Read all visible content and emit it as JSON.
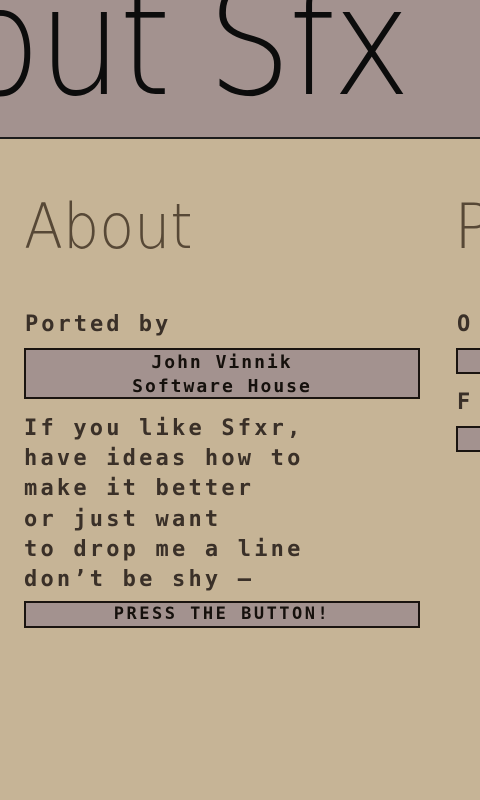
{
  "titlebar": {
    "title": "out Sfx"
  },
  "about": {
    "heading": "About",
    "ported_label": "Ported by",
    "credit": {
      "line1": "John Vinnik",
      "line2": "Software House"
    },
    "message_lines": [
      "If you like Sfxr,",
      "have ideas how to",
      "make it better",
      "or just want",
      "to drop me a line",
      "don’t be shy —"
    ],
    "button_label": "PRESS THE BUTTON!"
  },
  "next_section": {
    "heading_fragment": "P",
    "label1_fragment": "O",
    "label2_fragment": "F"
  },
  "colors": {
    "background": "#c6b496",
    "titlebar": "#a3928f",
    "heading": "#574836",
    "text": "#3a3028",
    "box_fill": "#a3928f",
    "box_border": "#1a1410"
  }
}
